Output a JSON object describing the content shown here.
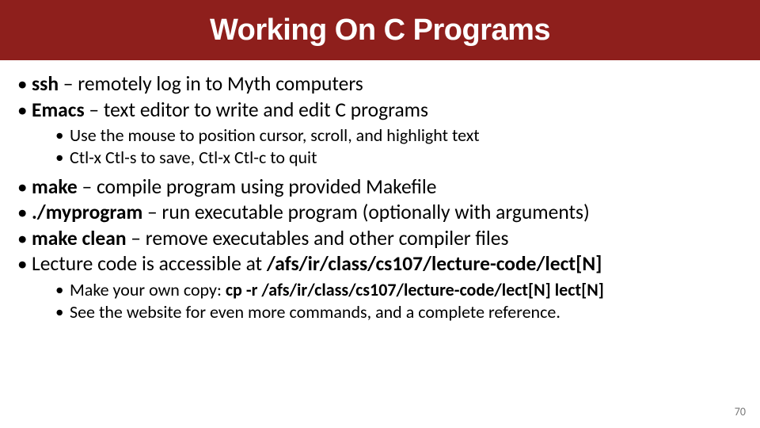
{
  "title": "Working On C Programs",
  "bullets": {
    "ssh_bold": "ssh",
    "ssh_rest": " – remotely log in to Myth computers",
    "emacs_bold": "Emacs",
    "emacs_rest": " – text editor to write and edit C programs",
    "emacs_sub1": "Use the mouse to position cursor, scroll, and highlight text",
    "emacs_sub2": "Ctl-x Ctl-s to save, Ctl-x Ctl-c to quit",
    "make_bold": "make",
    "make_rest": " – compile program using provided Makefile",
    "run_bold": "./myprogram",
    "run_rest": " – run executable program (optionally with arguments)",
    "clean_bold": "make clean",
    "clean_rest": " – remove executables and other compiler files",
    "lecture_pre": "Lecture code is accessible at ",
    "lecture_bold": "/afs/ir/class/cs107/lecture-code/lect[N]",
    "copy_pre": "Make your own copy: ",
    "copy_bold": "cp -r /afs/ir/class/cs107/lecture-code/lect[N] lect[N]",
    "website": "See the website for even more commands, and a complete reference."
  },
  "page_number": "70"
}
